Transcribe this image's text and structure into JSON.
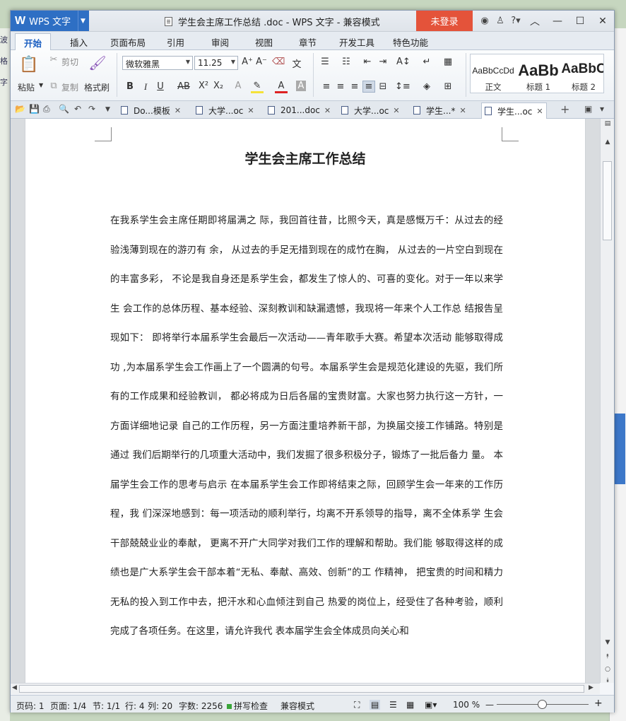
{
  "window": {
    "app_name": "WPS 文字",
    "title": "学生会主席工作总结 .doc - WPS 文字 - 兼容模式",
    "login_button": "未登录"
  },
  "menu_tabs": [
    "开始",
    "插入",
    "页面布局",
    "引用",
    "审阅",
    "视图",
    "章节",
    "开发工具",
    "特色功能"
  ],
  "ribbon": {
    "paste": "粘贴",
    "cut": "剪切",
    "copy": "复制",
    "format_painter": "格式刷",
    "font_name": "微软雅黑",
    "font_size": "11.25",
    "styles": [
      {
        "sample": "AaBbCcDd",
        "name": "正文"
      },
      {
        "sample": "AaBb",
        "name": "标题 1"
      },
      {
        "sample": "AaBbC",
        "name": "标题 2"
      }
    ]
  },
  "doc_tabs": [
    {
      "label": "Do...模板",
      "active": false
    },
    {
      "label": "大学...oc",
      "active": false
    },
    {
      "label": "201...doc",
      "active": false
    },
    {
      "label": "大学...oc",
      "active": false
    },
    {
      "label": "学生...*",
      "active": false
    },
    {
      "label": "学生...oc",
      "active": true
    }
  ],
  "document": {
    "title": "学生会主席工作总结",
    "body": "在我系学生会主席任期即将届满之 际，我回首往昔，比照今天，真是感慨万千：从过去的经验浅薄到现在的游刃有 余， 从过去的手足无措到现在的成竹在胸， 从过去的一片空白到现在的丰富多彩， 不论是我自身还是系学生会，都发生了惊人的、可喜的变化。对于一年以来学生 会工作的总体历程、基本经验、深刻教训和缺漏遗憾，我现将一年来个人工作总 结报告呈现如下： 即将举行本届系学生会最后一次活动——青年歌手大赛。希望本次活动 能够取得成功 ,为本届系学生会工作画上了一个圆满的句号。本届系学生会是规范化建设的先驱，我们所有的工作成果和经验教训， 都必将成为日后各届的宝贵财富。大家也努力执行这一方针，一方面详细地记录 自己的工作历程，另一方面注重培养新干部，为换届交接工作铺路。特别是通过 我们后期举行的几项重大活动中，我们发掘了很多积极分子，锻炼了一批后备力 量。 本届学生会工作的思考与启示 在本届系学生会工作即将结束之际，回顾学生会一年来的工作历程，我 们深深地感到：每一项活动的顺利举行，均离不开系领导的指导，离不全体系学 生会干部兢兢业业的奉献， 更离不开广大同学对我们工作的理解和帮助。我们能 够取得这样的成绩也是广大系学生会干部本着“无私、奉献、高效、创新”的工 作精神， 把宝贵的时间和精力无私的投入到工作中去，把汗水和心血倾注到自己 热爱的岗位上，经受住了各种考验，顺利完成了各项任务。在这里，请允许我代 表本届学生会全体成员向关心和"
  },
  "status": {
    "page_code": "页码: 1",
    "pages": "页面: 1/4",
    "section": "节: 1/1",
    "row": "行: 4",
    "col": "列: 20",
    "word_count": "字数: 2256",
    "spell_check": "拼写检查",
    "compat_mode": "兼容模式",
    "zoom": "100 %"
  },
  "colors": {
    "app_blue": "#2e6fc4",
    "login_red": "#e4533a",
    "active_tab_text": "#1b5fc1"
  }
}
